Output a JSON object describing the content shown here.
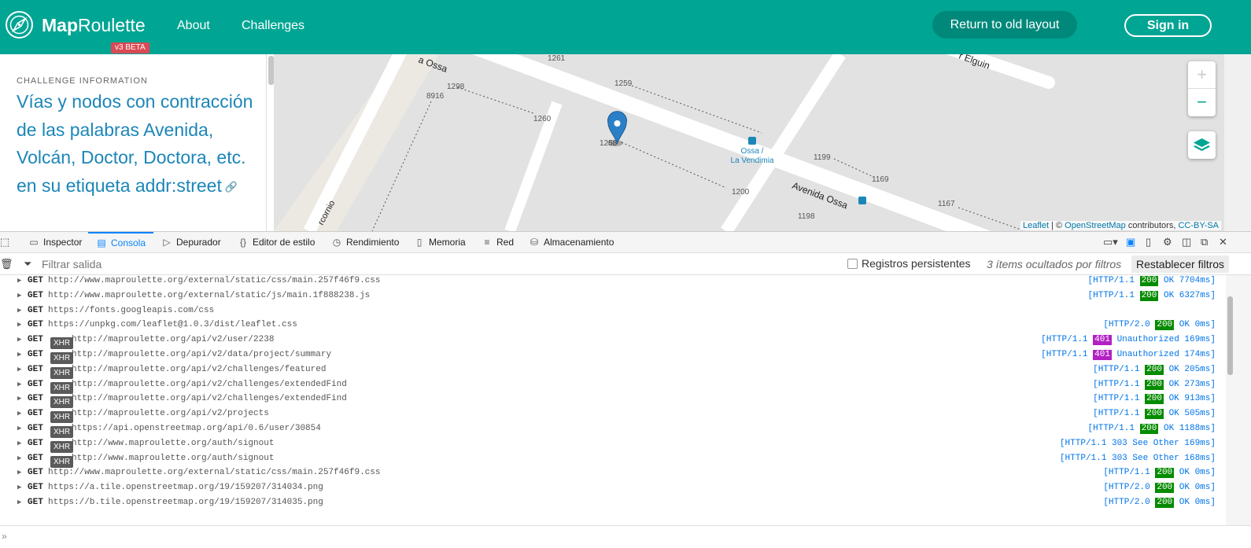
{
  "header": {
    "brand_bold": "Map",
    "brand_rest": "Roulette",
    "beta": "v3 BETA",
    "nav": [
      "About",
      "Challenges"
    ],
    "old_layout": "Return to old layout",
    "sign_in": "Sign in"
  },
  "panel": {
    "subtitle": "CHALLENGE INFORMATION",
    "title": "Vías y nodos con contracción de las palabras Avenida, Volcán, Doctor, Doctora, etc. en su etiqueta addr:street"
  },
  "map": {
    "streets": [
      "Avenida Ossa",
      "Elguin",
      "rcornio"
    ],
    "house_numbers": [
      "1261",
      "1298",
      "8916",
      "1259",
      "1260",
      "1258",
      "1199",
      "1169",
      "1200",
      "1198",
      "1167"
    ],
    "bus_stop": [
      "Ossa /",
      "La Vendimia"
    ],
    "zoom_in": "+",
    "zoom_out": "−",
    "attribution": {
      "leaflet": "Leaflet",
      "sep": " | © ",
      "osm": "OpenStreetMap",
      "contrib": " contributors, ",
      "license": "CC-BY-SA"
    }
  },
  "devtools": {
    "tabs": [
      "Inspector",
      "Consola",
      "Depurador",
      "Editor de estilo",
      "Rendimiento",
      "Memoria",
      "Red",
      "Almacenamiento"
    ],
    "active_tab": "Consola",
    "filter_placeholder": "Filtrar salida",
    "persist_label": "Registros persistentes",
    "hidden_count": "3 ítems ocultados por filtros",
    "reset_filters": "Restablecer filtros"
  },
  "log": [
    {
      "method": "GET",
      "xhr": false,
      "url": "http://www.maproulette.org/external/static/css/main.257f46f9.css",
      "proto": "[HTTP/1.1",
      "code": "200",
      "text": "OK 7704ms]"
    },
    {
      "method": "GET",
      "xhr": false,
      "url": "http://www.maproulette.org/external/static/js/main.1f888238.js",
      "proto": "[HTTP/1.1",
      "code": "200",
      "text": "OK 6327ms]"
    },
    {
      "method": "GET",
      "xhr": false,
      "url": "https://fonts.googleapis.com/css",
      "proto": "",
      "code": "",
      "text": ""
    },
    {
      "method": "GET",
      "xhr": false,
      "url": "https://unpkg.com/leaflet@1.0.3/dist/leaflet.css",
      "proto": "[HTTP/2.0",
      "code": "200",
      "text": "OK 0ms]"
    },
    {
      "method": "GET",
      "xhr": true,
      "url": "http://maproulette.org/api/v2/user/2238",
      "proto": "[HTTP/1.1",
      "code": "401",
      "text": "Unauthorized 169ms]"
    },
    {
      "method": "GET",
      "xhr": true,
      "url": "http://maproulette.org/api/v2/data/project/summary",
      "proto": "[HTTP/1.1",
      "code": "401",
      "text": "Unauthorized 174ms]"
    },
    {
      "method": "GET",
      "xhr": true,
      "url": "http://maproulette.org/api/v2/challenges/featured",
      "proto": "[HTTP/1.1",
      "code": "200",
      "text": "OK 205ms]"
    },
    {
      "method": "GET",
      "xhr": true,
      "url": "http://maproulette.org/api/v2/challenges/extendedFind",
      "proto": "[HTTP/1.1",
      "code": "200",
      "text": "OK 273ms]"
    },
    {
      "method": "GET",
      "xhr": true,
      "url": "http://maproulette.org/api/v2/challenges/extendedFind",
      "proto": "[HTTP/1.1",
      "code": "200",
      "text": "OK 913ms]"
    },
    {
      "method": "GET",
      "xhr": true,
      "url": "http://maproulette.org/api/v2/projects",
      "proto": "[HTTP/1.1",
      "code": "200",
      "text": "OK 505ms]"
    },
    {
      "method": "GET",
      "xhr": true,
      "url": "https://api.openstreetmap.org/api/0.6/user/30854",
      "proto": "[HTTP/1.1",
      "code": "200",
      "text": "OK 1188ms]"
    },
    {
      "method": "GET",
      "xhr": true,
      "url": "http://www.maproulette.org/auth/signout",
      "proto": "[HTTP/1.1",
      "code": "",
      "text": "303 See Other 169ms]"
    },
    {
      "method": "GET",
      "xhr": true,
      "url": "http://www.maproulette.org/auth/signout",
      "proto": "[HTTP/1.1",
      "code": "",
      "text": "303 See Other 168ms]"
    },
    {
      "method": "GET",
      "xhr": false,
      "url": "http://www.maproulette.org/external/static/css/main.257f46f9.css",
      "proto": "[HTTP/1.1",
      "code": "200",
      "text": "OK 0ms]"
    },
    {
      "method": "GET",
      "xhr": false,
      "url": "https://a.tile.openstreetmap.org/19/159207/314034.png",
      "proto": "[HTTP/2.0",
      "code": "200",
      "text": "OK 0ms]"
    },
    {
      "method": "GET",
      "xhr": false,
      "url": "https://b.tile.openstreetmap.org/19/159207/314035.png",
      "proto": "[HTTP/2.0",
      "code": "200",
      "text": "OK 0ms]"
    }
  ],
  "colors": {
    "brand": "#00a593",
    "link": "#1c86b8",
    "status_ok": "#058b00",
    "status_unauth": "#b320c4",
    "devtools_accent": "#0a84ff"
  }
}
